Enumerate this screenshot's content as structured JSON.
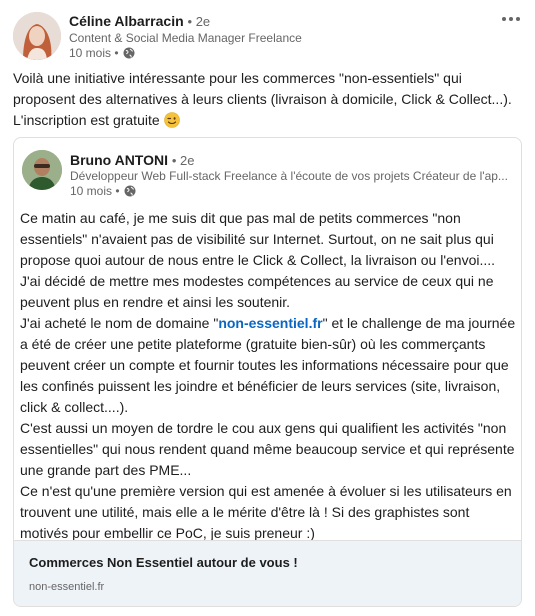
{
  "post": {
    "author": {
      "name": "Céline Albarracin",
      "degree": "• 2e",
      "subtitle": "Content & Social Media Manager Freelance",
      "time": "10 mois •"
    },
    "text": "Voilà une initiative intéressante pour les commerces \"non-essentiels\" qui proposent des alternatives à leurs clients (livraison à domicile, Click & Collect...). L'inscription est gratuite",
    "emoji": "wink-emoji-icon"
  },
  "shared": {
    "author": {
      "name": "Bruno ANTONI",
      "degree": "• 2e",
      "subtitle": "Développeur Web Full-stack Freelance à l'écoute de vos projets Créateur de l'ap...",
      "time": "10 mois •"
    },
    "paragraphs": {
      "p1": "Ce matin au café, je me suis dit que pas mal de petits commerces \"non essentiels\" n'avaient pas de visibilité sur Internet. Surtout, on ne sait plus qui propose quoi autour de nous entre le Click & Collect, la livraison ou l'envoi....",
      "p2": "J'ai décidé de mettre mes modestes compétences au service de ceux qui ne peuvent plus en rendre et ainsi les soutenir.",
      "p3_before": "J'ai acheté le nom de domaine \"",
      "p3_link": "non-essentiel.fr",
      "p3_after": "\" et le challenge de ma journée a été de créer une petite plateforme (gratuite bien-sûr) où les commerçants peuvent créer un compte et fournir toutes les informations nécessaire pour que les confinés puissent les joindre et bénéficier de leurs services (site, livraison, click & collect....).",
      "p4": "C'est aussi un moyen de tordre le cou aux gens qui qualifient les activités \"non essentielles\" qui nous rendent quand même beaucoup service et qui représente une grande part des PME...",
      "p5": "Ce n'est qu'une première version qui est amenée à évoluer si les utilisateurs en trouvent une utilité, mais elle a le mérite d'être là ! Si des graphistes sont motivés pour embellir ce PoC, je suis preneur :)"
    },
    "link_preview": {
      "title": "Commerces Non Essentiel autour de vous !",
      "domain": "non-essentiel.fr"
    }
  },
  "colors": {
    "link": "#0a66c2",
    "text": "#1d1d1d",
    "muted": "#666666",
    "preview_bg": "#eef3f8"
  }
}
